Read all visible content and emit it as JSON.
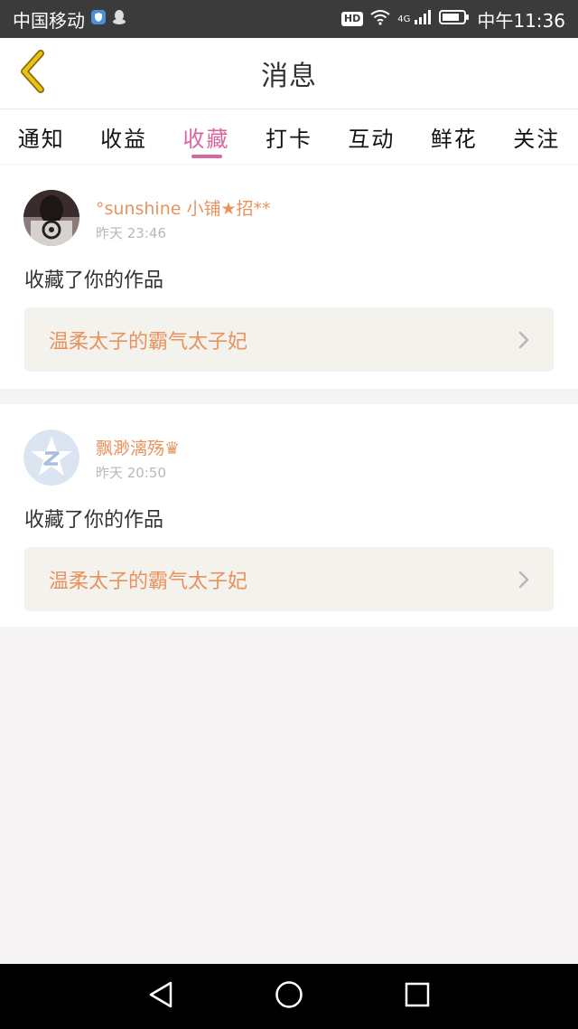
{
  "status_bar": {
    "carrier": "中国移动",
    "hd": "HD",
    "network": "4G",
    "time": "中午11:36"
  },
  "header": {
    "title": "消息"
  },
  "tabs": [
    {
      "label": "通知"
    },
    {
      "label": "收益"
    },
    {
      "label": "收藏"
    },
    {
      "label": "打卡"
    },
    {
      "label": "互动"
    },
    {
      "label": "鲜花"
    },
    {
      "label": "关注"
    }
  ],
  "active_tab": "收藏",
  "messages": [
    {
      "username": "°sunshine 小铺★招**",
      "time": "昨天 23:46",
      "action": "收藏了你的作品",
      "work_title": "温柔太子的霸气太子妃"
    },
    {
      "username": "飘渺漓殇♛",
      "time": "昨天 20:50",
      "action": "收藏了你的作品",
      "work_title": "温柔太子的霸气太子妃"
    }
  ],
  "colors": {
    "accent": "#d9669d",
    "username": "#e8935e",
    "work_link_bg": "#f4f2ed",
    "back_arrow": "#e6c21b"
  }
}
